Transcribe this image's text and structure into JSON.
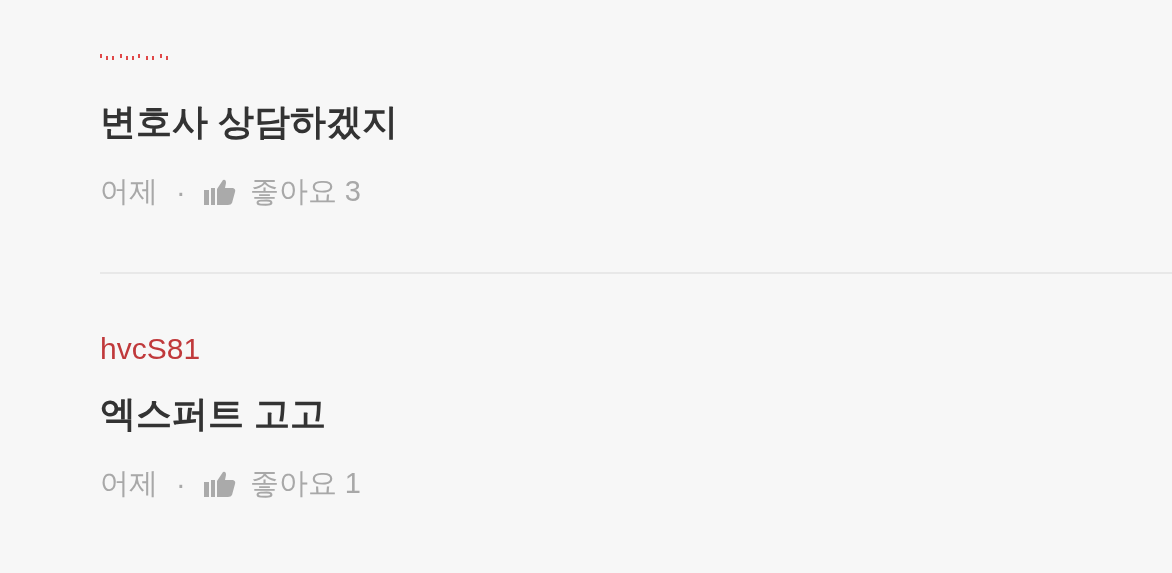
{
  "comments": [
    {
      "kind": "masked",
      "body": "변호사 상담하겠지",
      "time": "어제",
      "separator": "·",
      "likes": "좋아요 3"
    },
    {
      "kind": "named",
      "author": "hvcS81",
      "body": "엑스퍼트 고고",
      "time": "어제",
      "separator": "·",
      "likes": "좋아요 1"
    }
  ]
}
